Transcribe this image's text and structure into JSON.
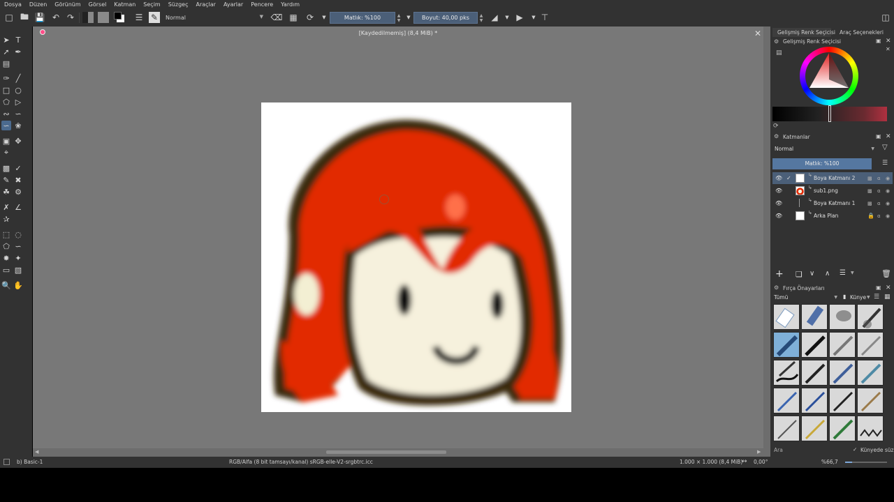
{
  "menu": [
    "Dosya",
    "Düzen",
    "Görünüm",
    "Görsel",
    "Katman",
    "Seçim",
    "Süzgeç",
    "Araçlar",
    "Ayarlar",
    "Pencere",
    "Yardım"
  ],
  "toolbar": {
    "blend_mode": "Normal",
    "opacity_label": "Matlık: %100",
    "size_label": "Boyut: 40,00 pks"
  },
  "document": {
    "title": "[Kaydedilmemiş] (8,4 MiB) *"
  },
  "docker": {
    "tab_color": "Gelişmiş Renk Seçicisi",
    "tab_tool": "Araç Seçenekleri",
    "color_panel_title": "Gelişmiş Renk Seçicisi",
    "layers_title": "Katmanlar",
    "layers_blend": "Normal",
    "layers_opacity": "Matlık: %100",
    "layers": [
      {
        "name": "Boya Katmanı 2",
        "selected": true
      },
      {
        "name": "sub1.png",
        "selected": false
      },
      {
        "name": "Boya Katmanı 1",
        "selected": false
      },
      {
        "name": "Arka Plan",
        "selected": false
      }
    ],
    "brush_title": "Fırça Önayarları",
    "brush_filter": "Tümü",
    "brush_tag": "Künye",
    "search_placeholder": "Ara",
    "tag_filter_label": "Künyede süz"
  },
  "status": {
    "brush": "b) Basic-1",
    "color_profile": "RGB/Alfa (8 bit tamsayı/kanal) sRGB-elle-V2-srgbtrc.icc",
    "dimensions": "1.000 × 1.000 (8,4 MiB)",
    "rotation": "0,00°",
    "zoom": "%66,7"
  },
  "colors": {
    "accent": "#4b5f78",
    "hair": "#e22a00",
    "hair_outline": "#3b2a10",
    "skin": "#f6f1dd"
  }
}
